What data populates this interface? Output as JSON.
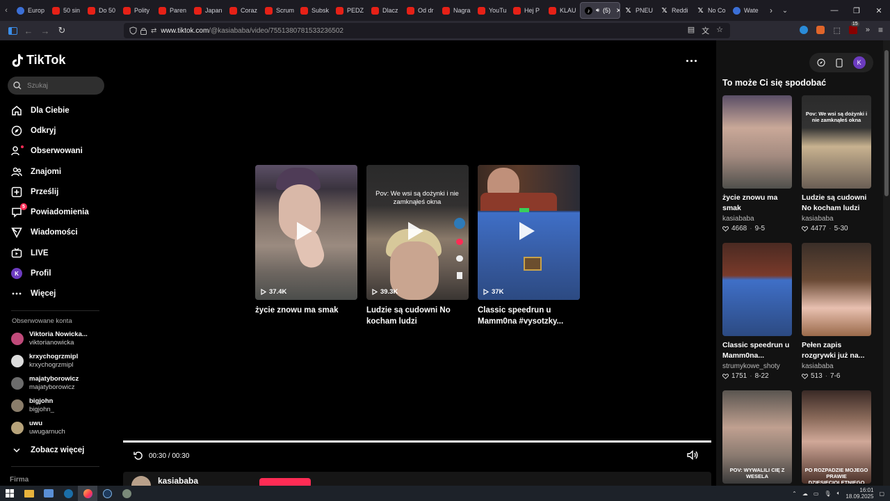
{
  "browser": {
    "tabs": [
      {
        "label": "Europ",
        "icon": "globe-icon"
      },
      {
        "label": "50 sin",
        "icon": "youtube-icon"
      },
      {
        "label": "Do 50",
        "icon": "youtube-icon"
      },
      {
        "label": "Polity",
        "icon": "youtube-icon"
      },
      {
        "label": "Paren",
        "icon": "youtube-icon"
      },
      {
        "label": "Japan",
        "icon": "youtube-icon"
      },
      {
        "label": "Coraz",
        "icon": "youtube-icon"
      },
      {
        "label": "Scrum",
        "icon": "youtube-icon"
      },
      {
        "label": "Subsk",
        "icon": "youtube-icon"
      },
      {
        "label": "PEDZ",
        "icon": "youtube-icon"
      },
      {
        "label": "Dlacz",
        "icon": "youtube-icon"
      },
      {
        "label": "Od dr",
        "icon": "youtube-icon"
      },
      {
        "label": "Nagra",
        "icon": "youtube-icon"
      },
      {
        "label": "YouTu",
        "icon": "youtube-icon"
      },
      {
        "label": "Hej P",
        "icon": "youtube-icon"
      },
      {
        "label": "KLAU",
        "icon": "youtube-icon"
      },
      {
        "label": "(5)",
        "icon": "tiktok-icon",
        "active": true
      },
      {
        "label": "PNEU",
        "icon": "x-icon"
      },
      {
        "label": "Reddi",
        "icon": "x-icon"
      },
      {
        "label": "No Co",
        "icon": "x-icon"
      },
      {
        "label": "Wate",
        "icon": "globe-icon"
      }
    ],
    "url_host": "www.tiktok.com",
    "url_path": "/@kasiababa/video/7551380781533236502",
    "ext_badge": "15"
  },
  "sidebar": {
    "brand": "TikTok",
    "search_placeholder": "Szukaj",
    "menu": [
      {
        "label": "Dla Ciebie",
        "icon": "home-icon"
      },
      {
        "label": "Odkryj",
        "icon": "compass-icon"
      },
      {
        "label": "Obserwowani",
        "icon": "person-follow-icon"
      },
      {
        "label": "Znajomi",
        "icon": "friends-icon"
      },
      {
        "label": "Prześlij",
        "icon": "upload-icon"
      },
      {
        "label": "Powiadomienia",
        "icon": "inbox-icon",
        "badge": "5"
      },
      {
        "label": "Wiadomości",
        "icon": "send-icon"
      },
      {
        "label": "LIVE",
        "icon": "live-icon"
      },
      {
        "label": "Profil",
        "icon": "profile-avatar"
      },
      {
        "label": "Więcej",
        "icon": "more-icon"
      }
    ],
    "profile_initial": "K",
    "followed_title": "Obserwowane konta",
    "followed": [
      {
        "name": "Viktoria Nowicka...",
        "user": "viktorianowicka",
        "color": "#c04a7a"
      },
      {
        "name": "krxychogrzmipl",
        "user": "krxychogrzmipl",
        "color": "#dcdcdc"
      },
      {
        "name": "majatyborowicz",
        "user": "majatyborowicz",
        "color": "#6c6c6c"
      },
      {
        "name": "bigjohn",
        "user": "bigjohn_",
        "color": "#8a7d6a"
      },
      {
        "name": "uwu",
        "user": "uwugarnuch",
        "color": "#b7a37a"
      }
    ],
    "see_more": "Zobacz więcej",
    "footer_label": "Firma"
  },
  "player": {
    "cards": [
      {
        "title": "życie znowu ma smak",
        "views": "37.4K"
      },
      {
        "title": "Ludzie są cudowni No kocham ludzi",
        "views": "39.3K",
        "overlay": "Pov: We wsi są dożynki i nie zamknąłeś okna"
      },
      {
        "title": "Classic speedrun u Mamm0na #vysotzky...",
        "views": "37K"
      }
    ],
    "time": "00:30 / 00:30",
    "progress_fraction": 1.0,
    "author": "kasiababa"
  },
  "recommend": {
    "title": "To może Ci się spodobać",
    "user_initial": "K",
    "items": [
      {
        "title": "życie znowu ma smak",
        "author": "kasiababa",
        "likes": "4668",
        "date": "9-5"
      },
      {
        "title": "Ludzie są cudowni No kocham ludzi",
        "author": "kasiababa",
        "likes": "4477",
        "date": "5-30",
        "overlay": "Pov: We wsi są dożynki i nie zamknąłeś okna"
      },
      {
        "title": "Classic speedrun u Mamm0na...",
        "author": "strumykowe_shoty",
        "likes": "1751",
        "date": "8-22"
      },
      {
        "title": "Pełen zapis rozgrywki już na...",
        "author": "kasiababa",
        "likes": "513",
        "date": "7-6"
      },
      {
        "title": "",
        "author": "",
        "likes": "",
        "date": "",
        "overlay": "POV: WYWALILI CIĘ Z WESELA"
      },
      {
        "title": "",
        "author": "",
        "likes": "",
        "date": "",
        "overlay": "PO ROZPADZIE MOJEGO PRAWIE DZIESIĘCIOLETNIEGO ZWIĄZKU"
      }
    ]
  },
  "taskbar": {
    "time": "16:01",
    "date": "18.09.2025"
  },
  "colors": {
    "accent": "#fe2c55",
    "bg": "#000000",
    "rail": "#121212"
  }
}
